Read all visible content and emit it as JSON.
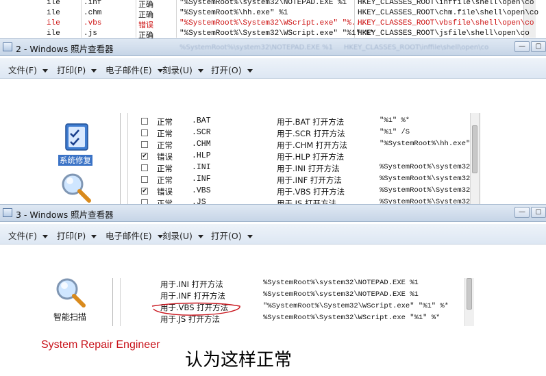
{
  "top_table": {
    "rows": [
      {
        "ext": ".inf",
        "status": "正确",
        "cmd": "\"%SystemRoot%\\system32\\NOTEPAD.EXE %1",
        "key": "HKEY_CLASSES_ROOT\\inffile\\shell\\open\\co",
        "error": false
      },
      {
        "ext": ".chm",
        "status": "正确",
        "cmd": "\"%SystemRoot%\\hh.exe\" %1",
        "key": "HKEY_CLASSES_ROOT\\chm.file\\shell\\open\\co",
        "error": false
      },
      {
        "ext": ".vbs",
        "status": "错误",
        "cmd": "\"%SystemRoot%\\System32\\WScript.exe\" \"%...",
        "key": "HKEY_CLASSES_ROOT\\vbsfile\\shell\\open\\co",
        "error": true
      },
      {
        "ext": ".js",
        "status": "正确",
        "cmd": "\"%SystemRoot%\\System32\\WScript.exe\" \"%1\" %*",
        "key": "HKEY_CLASSES_ROOT\\jsfile\\shell\\open\\co",
        "error": false
      }
    ],
    "row_prefix": "ile"
  },
  "window2": {
    "title": "2 - Windows 照片查看器",
    "menu": [
      "文件(F)",
      "打印(P)",
      "电子邮件(E)",
      "刻录(U)",
      "打开(O)"
    ],
    "sidebar_label": "系统修复",
    "rows": [
      {
        "checked": false,
        "status": "正常",
        "ext": ".BAT",
        "desc": "用于.BAT 打开方法",
        "cmd": "\"%1\" %*"
      },
      {
        "checked": false,
        "status": "正常",
        "ext": ".SCR",
        "desc": "用于.SCR 打开方法",
        "cmd": "\"%1\" /S"
      },
      {
        "checked": false,
        "status": "正常",
        "ext": ".CHM",
        "desc": "用于.CHM 打开方法",
        "cmd": "\"%SystemRoot%\\hh.exe\" \""
      },
      {
        "checked": true,
        "status": "错误",
        "ext": ".HLP",
        "desc": "用于.HLP 打开方法",
        "cmd": ""
      },
      {
        "checked": false,
        "status": "正常",
        "ext": ".INI",
        "desc": "用于.INI 打开方法",
        "cmd": "%SystemRoot%\\system32\\"
      },
      {
        "checked": false,
        "status": "正常",
        "ext": ".INF",
        "desc": "用于.INF 打开方法",
        "cmd": "%SystemRoot%\\system32\\"
      },
      {
        "checked": true,
        "status": "错误",
        "ext": ".VBS",
        "desc": "用于.VBS 打开方法",
        "cmd": "%SystemRoot%\\System32\\"
      },
      {
        "checked": false,
        "status": "正常",
        "ext": ".JS",
        "desc": "用于.JS 打开方法",
        "cmd": "%SystemRoot%\\System32\\"
      }
    ]
  },
  "window3": {
    "title": "3 - Windows 照片查看器",
    "menu": [
      "文件(F)",
      "打印(P)",
      "电子邮件(E)",
      "刻录(U)",
      "打开(O)"
    ],
    "sidebar_label": "智能扫描",
    "rows": [
      {
        "desc": "用于.INI 打开方法",
        "cmd": "%SystemRoot%\\system32\\NOTEPAD.EXE %1"
      },
      {
        "desc": "用于.INF 打开方法",
        "cmd": "%SystemRoot%\\system32\\NOTEPAD.EXE %1"
      },
      {
        "desc": "用于.VBS 打开方法",
        "cmd": "\"%SystemRoot%\\System32\\WScript.exe\" \"%1\" %*"
      },
      {
        "desc": "用于.JS 打开方法",
        "cmd": "%SystemRoot%\\System32\\WScript.exe \"%1\" %*"
      }
    ],
    "brand": "System Repair Engineer",
    "caption": "认为这样正常",
    "annotation_color": "#c8121a"
  }
}
